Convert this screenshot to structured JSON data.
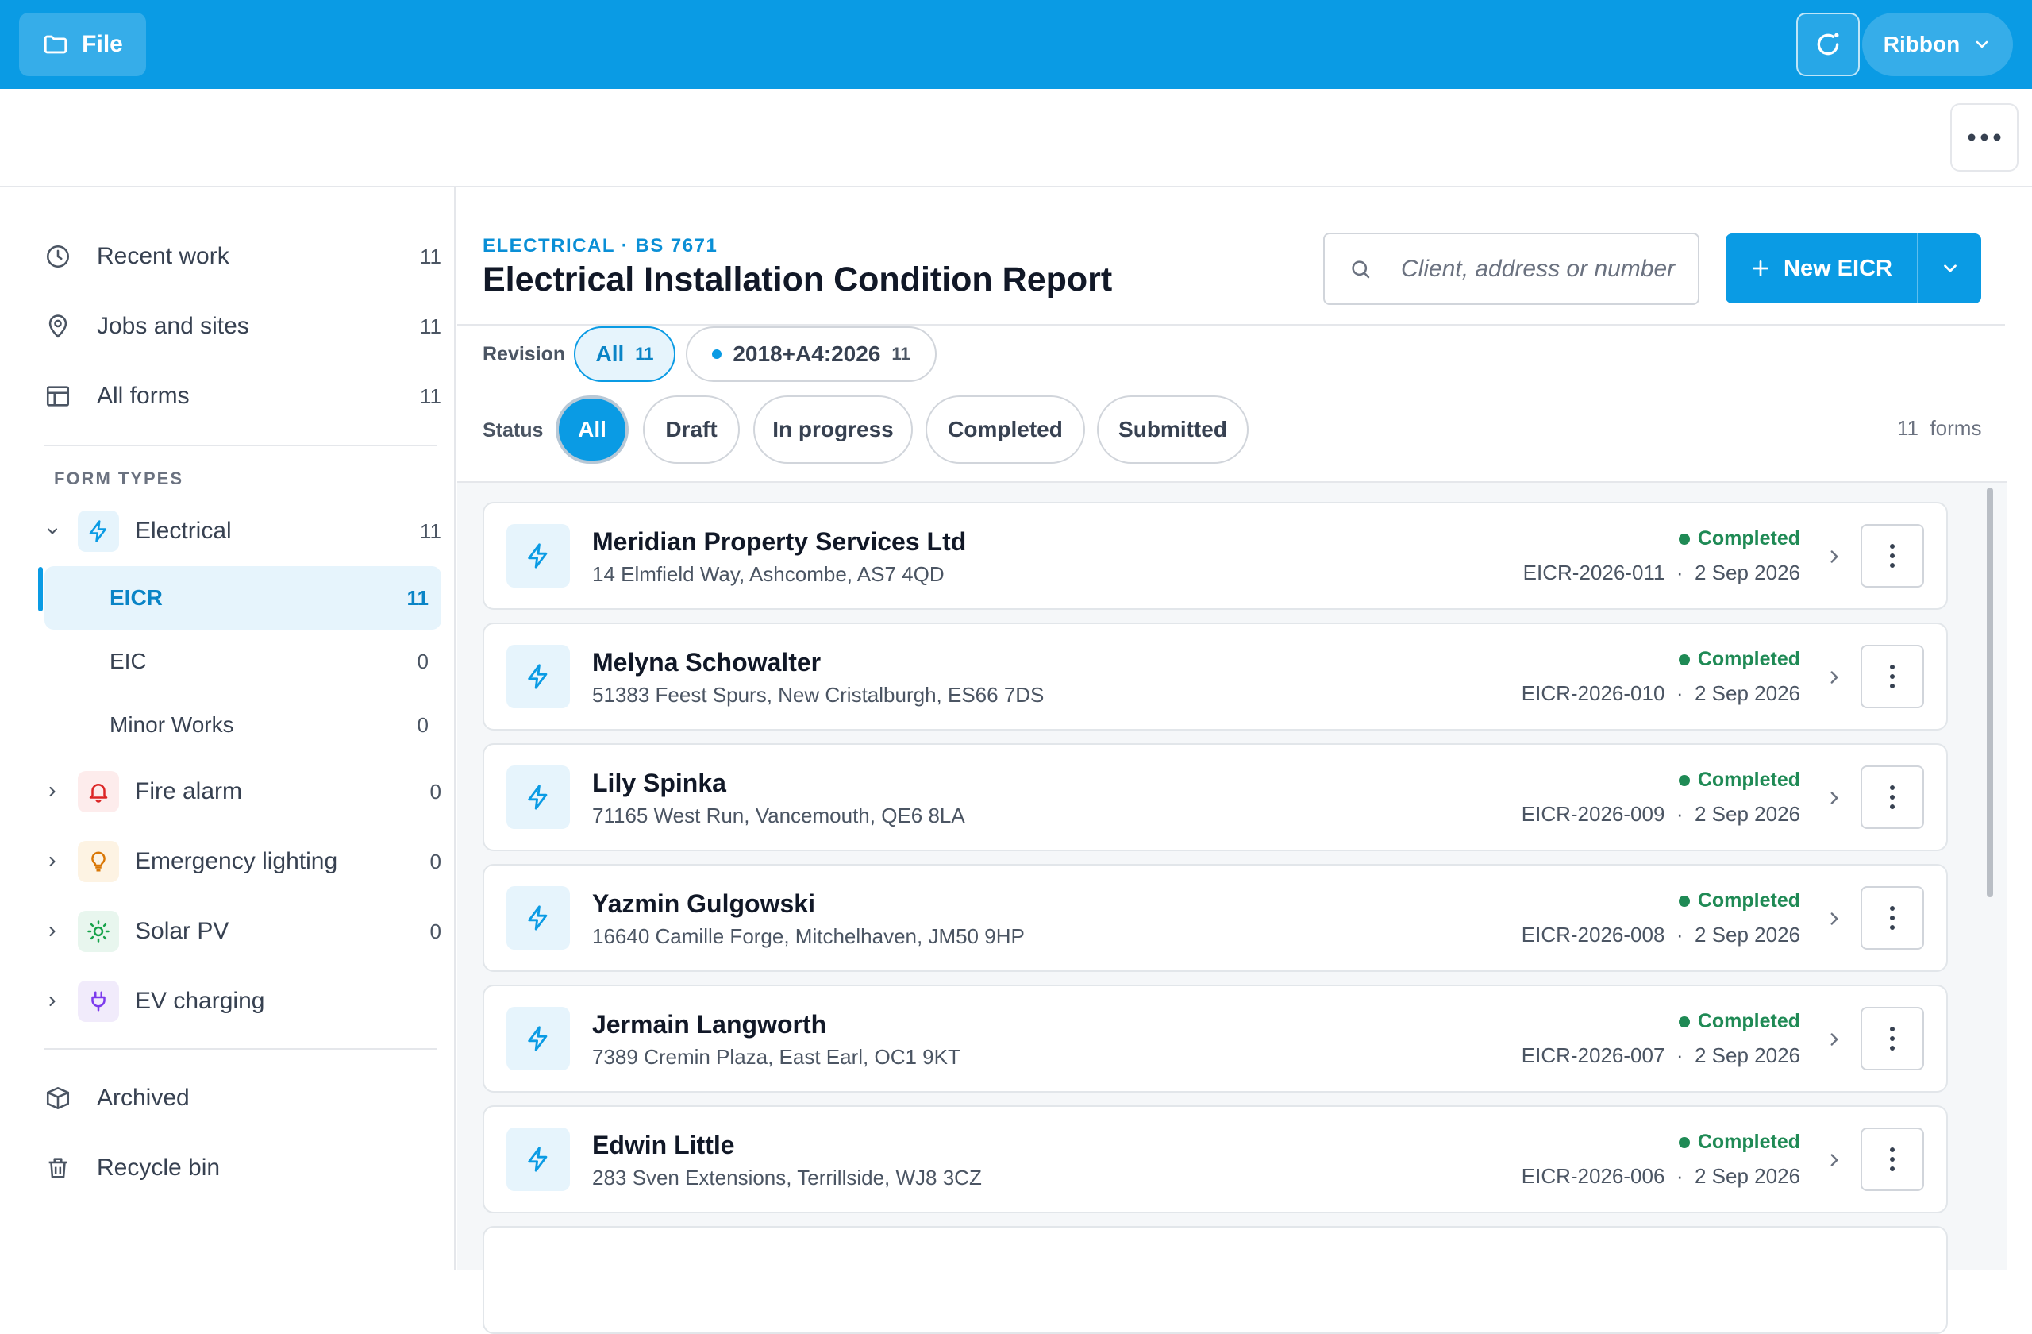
{
  "header": {
    "file_label": "File",
    "ribbon_label": "Ribbon",
    "brand_color": "#0a9be4"
  },
  "sidebar": {
    "nav": [
      {
        "label": "Recent work",
        "count": "11",
        "icon": "clock-icon"
      },
      {
        "label": "Jobs and sites",
        "count": "11",
        "icon": "map-pin-icon"
      },
      {
        "label": "All forms",
        "count": "11",
        "icon": "table-icon"
      }
    ],
    "section_title": "FORM TYPES",
    "types": [
      {
        "label": "Electrical",
        "count": "11",
        "icon": "lightning-icon",
        "expanded": true
      },
      {
        "label": "Fire alarm",
        "count": "0",
        "icon": "bell-icon"
      },
      {
        "label": "Emergency lighting",
        "count": "0",
        "icon": "bulb-icon"
      },
      {
        "label": "Solar PV",
        "count": "0",
        "icon": "sun-icon"
      },
      {
        "label": "EV charging",
        "count": "",
        "icon": "plug-icon"
      }
    ],
    "electrical_sub": [
      {
        "label": "EICR",
        "count": "11",
        "active": true
      },
      {
        "label": "EIC",
        "count": "0"
      },
      {
        "label": "Minor Works",
        "count": "0"
      }
    ],
    "bottom": [
      {
        "label": "Archived",
        "icon": "box-icon"
      },
      {
        "label": "Recycle bin",
        "icon": "trash-icon"
      }
    ]
  },
  "main": {
    "eyebrow": "ELECTRICAL · BS 7671",
    "title": "Electrical Installation Condition Report",
    "search_placeholder": "Client, address or number",
    "new_button": "New EICR",
    "revision_label": "Revision",
    "revision_chips": [
      {
        "label": "All",
        "count": "11",
        "selected": true
      },
      {
        "label": "2018+A4:2026",
        "count": "11"
      }
    ],
    "status_label": "Status",
    "status_chips": [
      "All",
      "Draft",
      "In progress",
      "Completed",
      "Submitted"
    ],
    "status_selected": "All",
    "forms_count": "11",
    "forms_word": "forms"
  },
  "records": [
    {
      "name": "Meridian Property Services Ltd",
      "address": "14 Elmfield Way, Ashcombe, AS7 4QD",
      "status": "Completed",
      "ref": "EICR-2026-011",
      "date": "2 Sep 2026"
    },
    {
      "name": "Melyna Schowalter",
      "address": "51383 Feest Spurs, New Cristalburgh, ES66 7DS",
      "status": "Completed",
      "ref": "EICR-2026-010",
      "date": "2 Sep 2026"
    },
    {
      "name": "Lily Spinka",
      "address": "71165 West Run, Vancemouth, QE6 8LA",
      "status": "Completed",
      "ref": "EICR-2026-009",
      "date": "2 Sep 2026"
    },
    {
      "name": "Yazmin Gulgowski",
      "address": "16640 Camille Forge, Mitchelhaven, JM50 9HP",
      "status": "Completed",
      "ref": "EICR-2026-008",
      "date": "2 Sep 2026"
    },
    {
      "name": "Jermain Langworth",
      "address": "7389 Cremin Plaza, East Earl, OC1 9KT",
      "status": "Completed",
      "ref": "EICR-2026-007",
      "date": "2 Sep 2026"
    },
    {
      "name": "Edwin Little",
      "address": "283 Sven Extensions, Terrillside, WJ8 3CZ",
      "status": "Completed",
      "ref": "EICR-2026-006",
      "date": "2 Sep 2026"
    }
  ],
  "meta_separator": "·"
}
